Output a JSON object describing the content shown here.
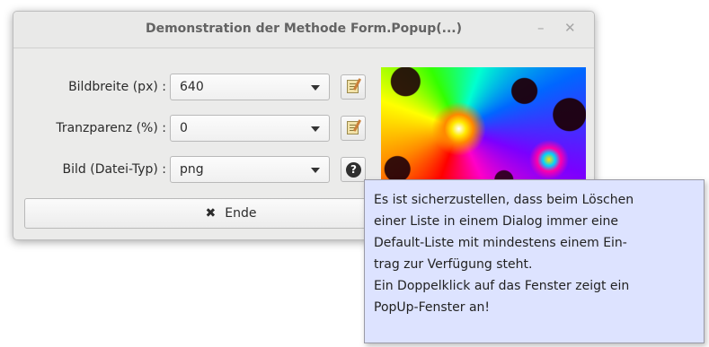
{
  "window": {
    "title": "Demonstration der Methode Form.Popup(...)",
    "minimize_symbol": "–",
    "close_symbol": "✕"
  },
  "form": {
    "rows": [
      {
        "label": "Bildbreite (px) :",
        "value": "640",
        "button_icon": "notepad-edit-icon"
      },
      {
        "label": "Tranzparenz (%) :",
        "value": "0",
        "button_icon": "notepad-edit-icon"
      },
      {
        "label": "Bild (Datei-Typ) :",
        "value": "png",
        "button_icon": "help-icon"
      }
    ],
    "end_button": {
      "icon_glyph": "✖",
      "label": "Ende"
    }
  },
  "help_glyph": "?",
  "tooltip": {
    "lines": [
      "Es ist sicherzustellen, dass beim Löschen",
      "einer Liste in einem Dialog immer eine",
      "Default-Liste mit mindestens einem Ein-",
      "trag zur Verfügung steht.",
      "Ein Doppelklick auf das Fenster zeigt ein",
      "PopUp-Fenster an!"
    ]
  },
  "colors": {
    "tooltip_bg": "#dde3ff",
    "window_bg": "#ebebea",
    "title_text": "#636363"
  }
}
